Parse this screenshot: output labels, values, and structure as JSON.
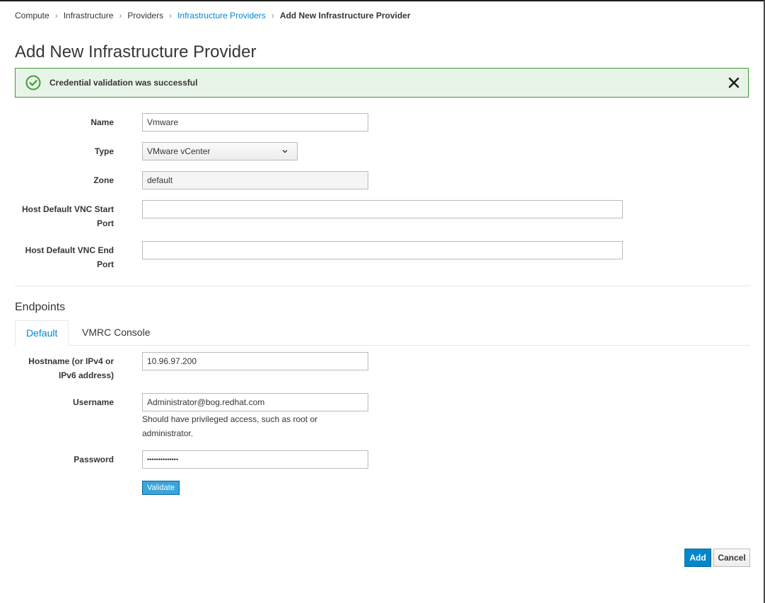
{
  "breadcrumb": {
    "items": [
      "Compute",
      "Infrastructure",
      "Providers",
      "Infrastructure Providers",
      "Add New Infrastructure Provider"
    ],
    "separator": "›"
  },
  "page": {
    "title": "Add New Infrastructure Provider"
  },
  "alert": {
    "message": "Credential validation was successful",
    "type": "success",
    "icon": "check-circle-icon",
    "color": "#3f9c35"
  },
  "form": {
    "name": {
      "label": "Name",
      "value": "Vmware"
    },
    "type": {
      "label": "Type",
      "value": "VMware vCenter"
    },
    "zone": {
      "label": "Zone",
      "value": "default"
    },
    "vnc_start": {
      "label_line1": "Host Default VNC Start",
      "label_line2": "Port",
      "value": ""
    },
    "vnc_end": {
      "label_line1": "Host Default VNC End",
      "label_line2": "Port",
      "value": ""
    }
  },
  "endpoints": {
    "title": "Endpoints",
    "tabs": [
      {
        "label": "Default",
        "active": true
      },
      {
        "label": "VMRC Console",
        "active": false
      }
    ],
    "hostname": {
      "label_line1": "Hostname (or IPv4 or",
      "label_line2": "IPv6 address)",
      "value": "10.96.97.200"
    },
    "username": {
      "label": "Username",
      "value": "Administrator@bog.redhat.com",
      "help_line1": "Should have privileged access, such as root or",
      "help_line2": "administrator."
    },
    "password": {
      "label": "Password",
      "value": "••••••••••••••"
    },
    "validate_label": "Validate"
  },
  "actions": {
    "add_label": "Add",
    "cancel_label": "Cancel"
  },
  "colors": {
    "link": "#0088ce",
    "primary": "#0088ce",
    "success": "#3f9c35"
  }
}
